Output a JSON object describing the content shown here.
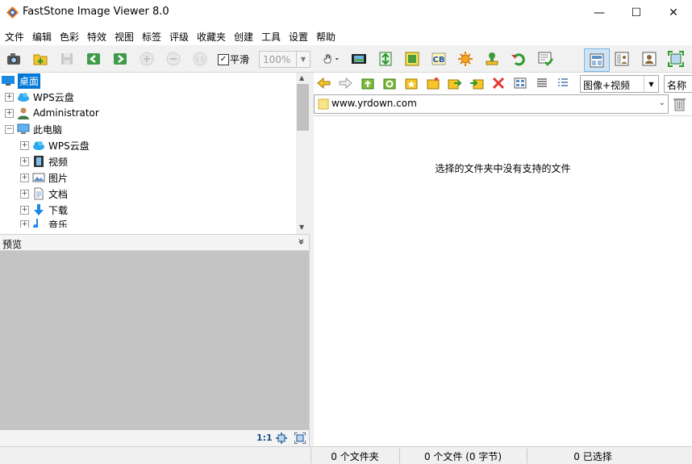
{
  "window": {
    "title": "FastStone Image Viewer 8.0",
    "minimize": "—",
    "maximize": "☐",
    "close": "✕"
  },
  "menu": [
    "文件",
    "编辑",
    "色彩",
    "特效",
    "视图",
    "标签",
    "评级",
    "收藏夹",
    "创建",
    "工具",
    "设置",
    "帮助"
  ],
  "toolbar": {
    "smooth_checked": "✓",
    "smooth_label": "平滑",
    "zoom_value": "100%"
  },
  "tree": {
    "root": "桌面",
    "items": [
      "WPS云盘",
      "Administrator",
      "此电脑",
      "WPS云盘",
      "视频",
      "图片",
      "文档",
      "下载",
      "音乐"
    ]
  },
  "preview": {
    "label": "预览",
    "collapse_glyph": "»",
    "ratio": "1:1"
  },
  "browser": {
    "filter": "图像+视频",
    "sort": "名称",
    "path": "www.yrdown.com",
    "empty_message": "选择的文件夹中没有支持的文件"
  },
  "status": {
    "folders": "0 个文件夹",
    "files": "0 个文件 (0 字节)",
    "selected": "0 已选择"
  },
  "colors": {
    "selection": "#0078d7",
    "preview_bg": "#c4c4c4",
    "toolbar_bg": "#f1f1f1"
  }
}
